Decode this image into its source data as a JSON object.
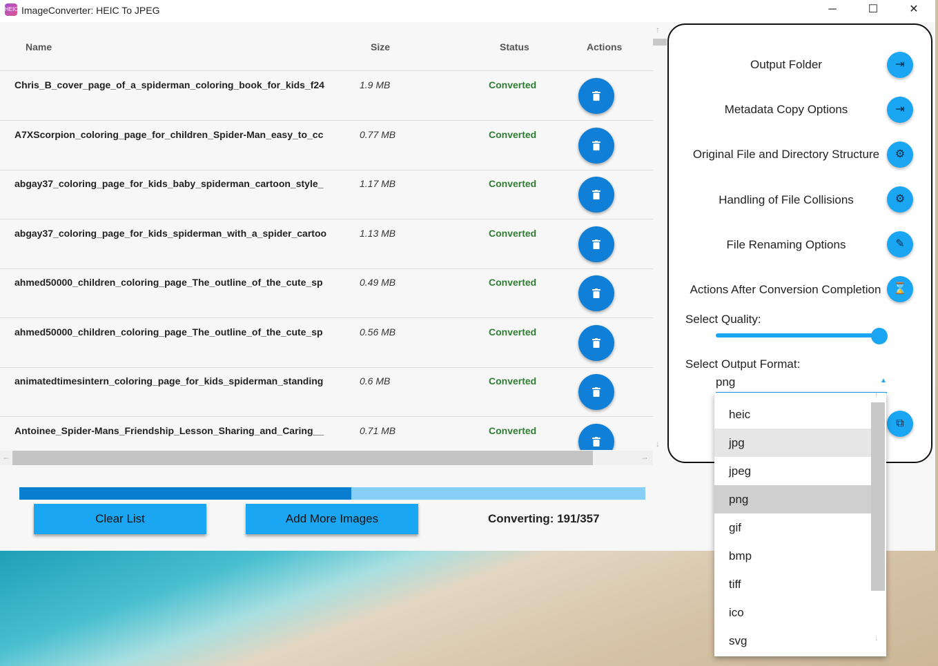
{
  "window": {
    "title": "ImageConverter: HEIC To JPEG",
    "app_icon": "heic-app-icon",
    "controls": {
      "minimize": "─",
      "maximize": "☐",
      "close": "✕"
    }
  },
  "table": {
    "columns": [
      "Name",
      "Size",
      "Status",
      "Actions"
    ],
    "rows": [
      {
        "name": "Chris_B_cover_page_of_a_spiderman_coloring_book_for_kids_f24",
        "size": "1.9 MB",
        "status": "Converted"
      },
      {
        "name": "A7XScorpion_coloring_page_for_children_Spider-Man_easy_to_cc",
        "size": "0.77 MB",
        "status": "Converted"
      },
      {
        "name": "abgay37_coloring_page_for_kids_baby_spiderman_cartoon_style_",
        "size": "1.17 MB",
        "status": "Converted"
      },
      {
        "name": "abgay37_coloring_page_for_kids_spiderman_with_a_spider_cartoo",
        "size": "1.13 MB",
        "status": "Converted"
      },
      {
        "name": "ahmed50000_children_coloring_page_The_outline_of_the_cute_sp",
        "size": "0.49 MB",
        "status": "Converted"
      },
      {
        "name": "ahmed50000_children_coloring_page_The_outline_of_the_cute_sp",
        "size": "0.56 MB",
        "status": "Converted"
      },
      {
        "name": "animatedtimesintern_coloring_page_for_kids_spiderman_standing",
        "size": "0.6 MB",
        "status": "Converted"
      },
      {
        "name": "Antoinee_Spider-Mans_Friendship_Lesson_Sharing_and_Caring__",
        "size": "0.71 MB",
        "status": "Converted"
      }
    ],
    "delete_icon": "trash-icon",
    "status_color": "#2e7d32"
  },
  "scrollbars": {
    "up": "↑",
    "down": "↓",
    "left": "←",
    "right": "→"
  },
  "progress": {
    "fraction": 0.53,
    "fill_color": "#0a7fd1",
    "track_color": "#87cff8"
  },
  "actions": {
    "clear_label": "Clear List",
    "add_label": "Add More Images",
    "converting_text": "Converting: 191/357"
  },
  "settings": {
    "options": [
      {
        "label": "Output Folder",
        "icon": "logout-icon",
        "glyph": "⇥"
      },
      {
        "label": "Metadata Copy Options",
        "icon": "logout-icon",
        "glyph": "⇥"
      },
      {
        "label": "Original File and Directory Structure",
        "icon": "gear-icon",
        "glyph": "⚙"
      },
      {
        "label": "Handling of File Collisions",
        "icon": "gear-icon",
        "glyph": "⚙"
      },
      {
        "label": "File Renaming Options",
        "icon": "edit-icon",
        "glyph": "✎"
      },
      {
        "label": "Actions After Conversion Completion",
        "icon": "hourglass-icon",
        "glyph": "⌛"
      }
    ],
    "quality_label": "Select Quality:",
    "quality_level": 1.0,
    "format_label": "Select Output Format:",
    "format_value": "png",
    "format_arrow": "▲",
    "open_icon": "open-external-icon",
    "open_glyph": "⧉",
    "accent": "#1aa6f2"
  },
  "format_dropdown": {
    "options": [
      "heic",
      "jpg",
      "jpeg",
      "png",
      "gif",
      "bmp",
      "tiff",
      "ico",
      "svg"
    ],
    "hovered": "jpg",
    "selected": "png"
  }
}
